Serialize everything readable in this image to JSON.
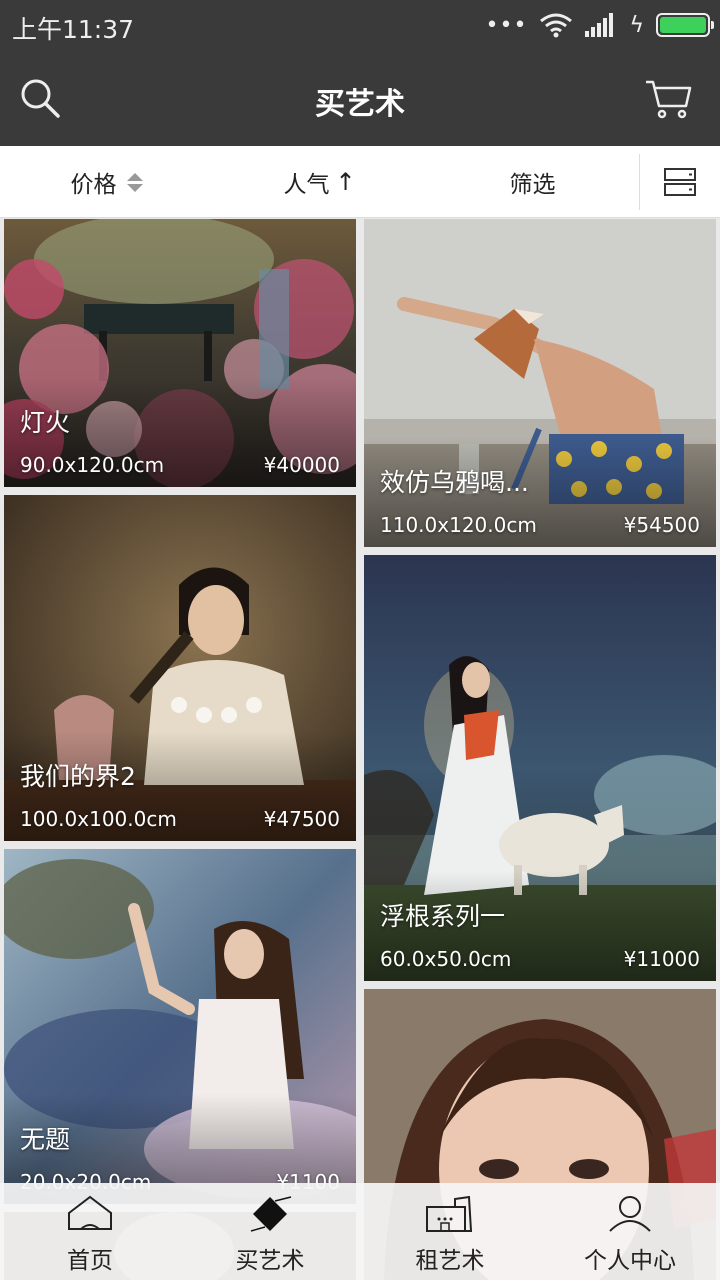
{
  "status_bar": {
    "time": "上午11:37",
    "dots": "•••",
    "battery_color": "#3dd15b"
  },
  "app_bar": {
    "title": "买艺术",
    "left_icon": "search-icon",
    "right_icon": "cart-icon",
    "background": "#3a3a3a"
  },
  "filter_bar": {
    "price_label": "价格",
    "popularity_label": "人气",
    "filter_label": "筛选",
    "popularity_arrow": "↑",
    "layout_icon": "list-layout-icon"
  },
  "artworks": [
    {
      "title": "灯火",
      "size": "90.0x120.0cm",
      "price": "¥40000"
    },
    {
      "title": "效仿乌鸦喝...",
      "size": "110.0x120.0cm",
      "price": "¥54500"
    },
    {
      "title": "我们的界2",
      "size": "100.0x100.0cm",
      "price": "¥47500"
    },
    {
      "title": "浮根系列一",
      "size": "60.0x50.0cm",
      "price": "¥11000"
    },
    {
      "title": "无题",
      "size": "20.0x20.0cm",
      "price": "¥1100"
    },
    {
      "title": "",
      "size": "",
      "price": ""
    },
    {
      "title": "",
      "size": "",
      "price": ""
    }
  ],
  "bottom_nav": [
    {
      "label": "首页",
      "icon": "home-icon",
      "active": false
    },
    {
      "label": "买艺术",
      "icon": "buy-art-icon",
      "active": true
    },
    {
      "label": "租艺术",
      "icon": "rent-art-icon",
      "active": false
    },
    {
      "label": "个人中心",
      "icon": "profile-icon",
      "active": false
    }
  ]
}
